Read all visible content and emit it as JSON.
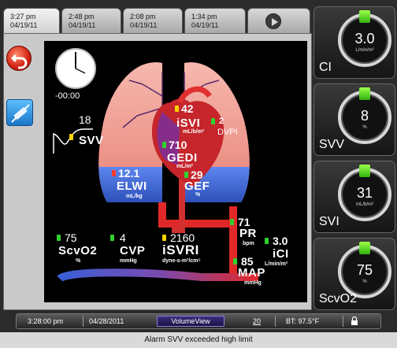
{
  "tabs": [
    {
      "time": "3:27 pm",
      "date": "04/19/11",
      "active": true
    },
    {
      "time": "2:48 pm",
      "date": "04/19/11",
      "active": false
    },
    {
      "time": "2:08 pm",
      "date": "04/19/11",
      "active": false
    },
    {
      "time": "1:34 pm",
      "date": "04/19/11",
      "active": false
    }
  ],
  "left_panel": {
    "timer": "-00:00"
  },
  "diagram": {
    "isvi": {
      "value": "42",
      "label": "iSVI",
      "unit": "mL/b/m²"
    },
    "dvpi": {
      "value": "2",
      "label": "DVPI"
    },
    "gedi": {
      "value": "710",
      "label": "GEDI",
      "unit": "mL/m²"
    },
    "elwi": {
      "value": "12.1",
      "label": "ELWI",
      "unit": "mL/kg"
    },
    "gef": {
      "value": "29",
      "label": "GEF",
      "unit": "%"
    },
    "svv": {
      "value": "18",
      "label": "SVV"
    },
    "pr": {
      "value": "71",
      "label": "PR",
      "unit": "bpm"
    },
    "ici": {
      "value": "3.0",
      "label": "iCI",
      "unit": "L/min/m²"
    },
    "map": {
      "value": "85",
      "label": "MAP",
      "unit": "mmHg"
    },
    "scvo2": {
      "value": "75",
      "label": "ScvO2",
      "unit": "%"
    },
    "cvp": {
      "value": "4",
      "label": "CVP",
      "unit": "mmHg"
    },
    "isvri": {
      "value": "2160",
      "label": "iSVRI",
      "unit": "dyne-s-m²/cm⁵"
    }
  },
  "right_cards": [
    {
      "name": "CI",
      "value": "3.0",
      "unit": "L/min/m²"
    },
    {
      "name": "SVV",
      "value": "8",
      "unit": "%"
    },
    {
      "name": "SVI",
      "value": "31",
      "unit": "mL/b/m²"
    },
    {
      "name": "ScvO2",
      "value": "75",
      "unit": "%"
    }
  ],
  "status_bar": {
    "time": "3:28:00 pm",
    "date": "04/28/2011",
    "app": "VolumeView",
    "count": "20",
    "temp": "BT: 97.5°F"
  },
  "alarm": "Alarm SVV exceeded high limit",
  "colors": {
    "flag_green": "#2fd12f",
    "flag_yellow": "#ffd200",
    "flag_red": "#ff3b2f",
    "card_green": "#5ce62a",
    "lung": "#f4a39a",
    "fluid": "#3f66d6"
  }
}
